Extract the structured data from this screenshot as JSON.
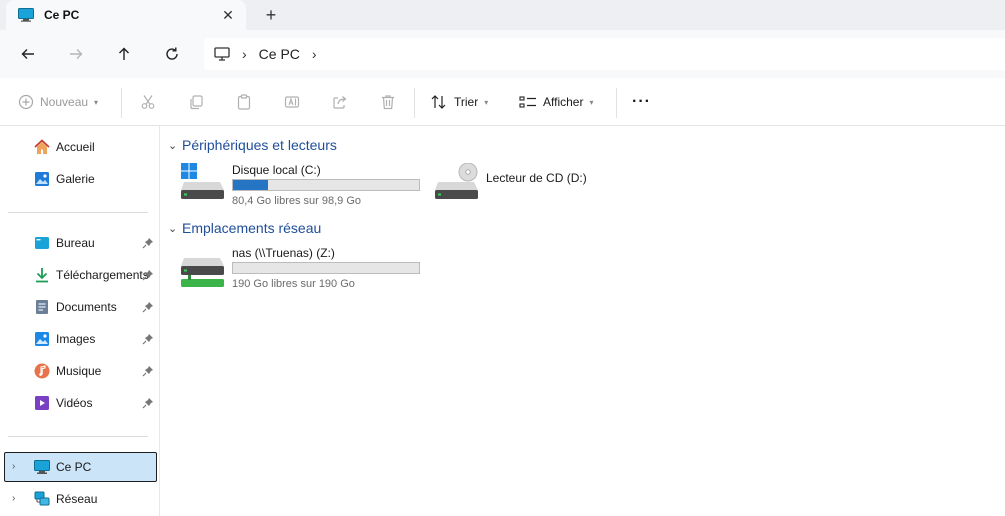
{
  "tab": {
    "title": "Ce PC",
    "close_symbol": "✕",
    "new_tab_symbol": "+"
  },
  "address": {
    "crumbs": [
      "Ce PC"
    ],
    "separator": "›"
  },
  "toolbar": {
    "new_label": "Nouveau",
    "sort_label": "Trier",
    "view_label": "Afficher",
    "more_symbol": "···"
  },
  "sidebar": {
    "top_items": [
      {
        "label": "Accueil",
        "icon": "home-icon"
      },
      {
        "label": "Galerie",
        "icon": "gallery-icon"
      }
    ],
    "pinned_items": [
      {
        "label": "Bureau",
        "icon": "desktop-folder-icon"
      },
      {
        "label": "Téléchargements",
        "icon": "download-icon"
      },
      {
        "label": "Documents",
        "icon": "documents-icon"
      },
      {
        "label": "Images",
        "icon": "pictures-icon"
      },
      {
        "label": "Musique",
        "icon": "music-icon"
      },
      {
        "label": "Vidéos",
        "icon": "videos-icon"
      }
    ],
    "tree_items": [
      {
        "label": "Ce PC",
        "icon": "computer-icon",
        "selected": true
      },
      {
        "label": "Réseau",
        "icon": "network-icon",
        "selected": false
      }
    ]
  },
  "main": {
    "groups": [
      {
        "title": "Périphériques et lecteurs",
        "drives": [
          {
            "name": "Disque local (C:)",
            "free": "80,4 Go libres sur 98,9 Go",
            "used_fraction": 0.187,
            "icon": "system-drive-icon"
          },
          {
            "name": "Lecteur de CD (D:)",
            "icon": "cd-drive-icon"
          }
        ]
      },
      {
        "title": "Emplacements réseau",
        "drives": [
          {
            "name": "nas (\\\\Truenas) (Z:)",
            "free": "190 Go libres sur 190 Go",
            "used_fraction": 0.0,
            "icon": "network-drive-icon"
          }
        ]
      }
    ]
  },
  "colors": {
    "accent": "#2675c5",
    "group_title": "#1f4e9b",
    "selection": "#cce4f7"
  }
}
